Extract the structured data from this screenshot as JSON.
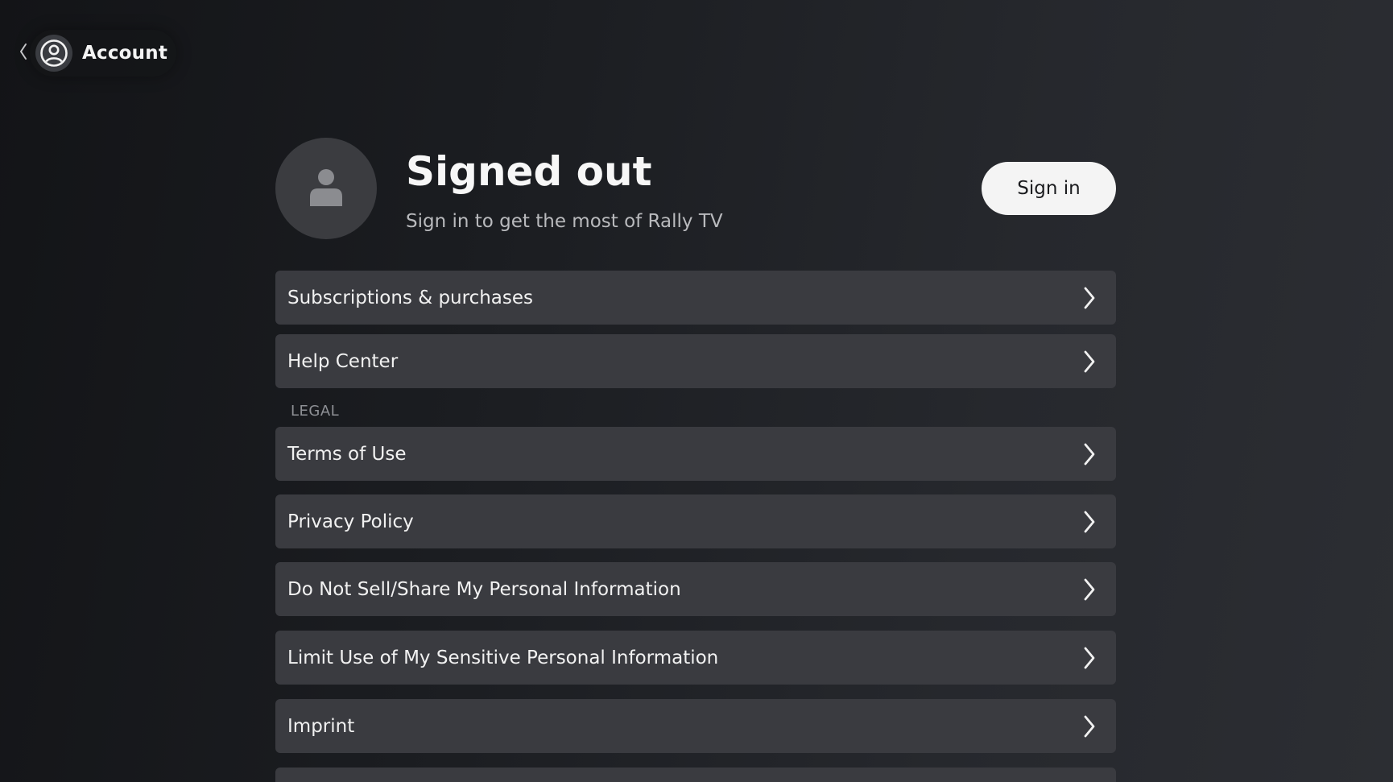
{
  "header": {
    "back_icon": "chevron-left-icon",
    "account_icon": "user-circle-icon",
    "title": "Account"
  },
  "profile": {
    "avatar_icon": "person-icon",
    "status_title": "Signed out",
    "status_subtitle": "Sign in to get the most of Rally TV",
    "sign_in_label": "Sign in"
  },
  "menu": {
    "general_items": [
      {
        "label": "Subscriptions & purchases",
        "icon": "chevron-right-icon"
      },
      {
        "label": "Help Center",
        "icon": "chevron-right-icon"
      }
    ],
    "legal_section_label": "LEGAL",
    "legal_items": [
      {
        "label": "Terms of Use",
        "icon": "chevron-right-icon"
      },
      {
        "label": "Privacy Policy",
        "icon": "chevron-right-icon"
      },
      {
        "label": "Do Not Sell/Share My Personal Information",
        "icon": "chevron-right-icon"
      },
      {
        "label": "Limit Use of My Sensitive Personal Information",
        "icon": "chevron-right-icon"
      },
      {
        "label": "Imprint",
        "icon": "chevron-right-icon"
      }
    ]
  },
  "colors": {
    "background_dark": "#131417",
    "row_background": "#3a3b40",
    "button_background": "#f4f4f4",
    "text_primary": "#f1f1f1",
    "text_secondary": "#b9babd"
  }
}
